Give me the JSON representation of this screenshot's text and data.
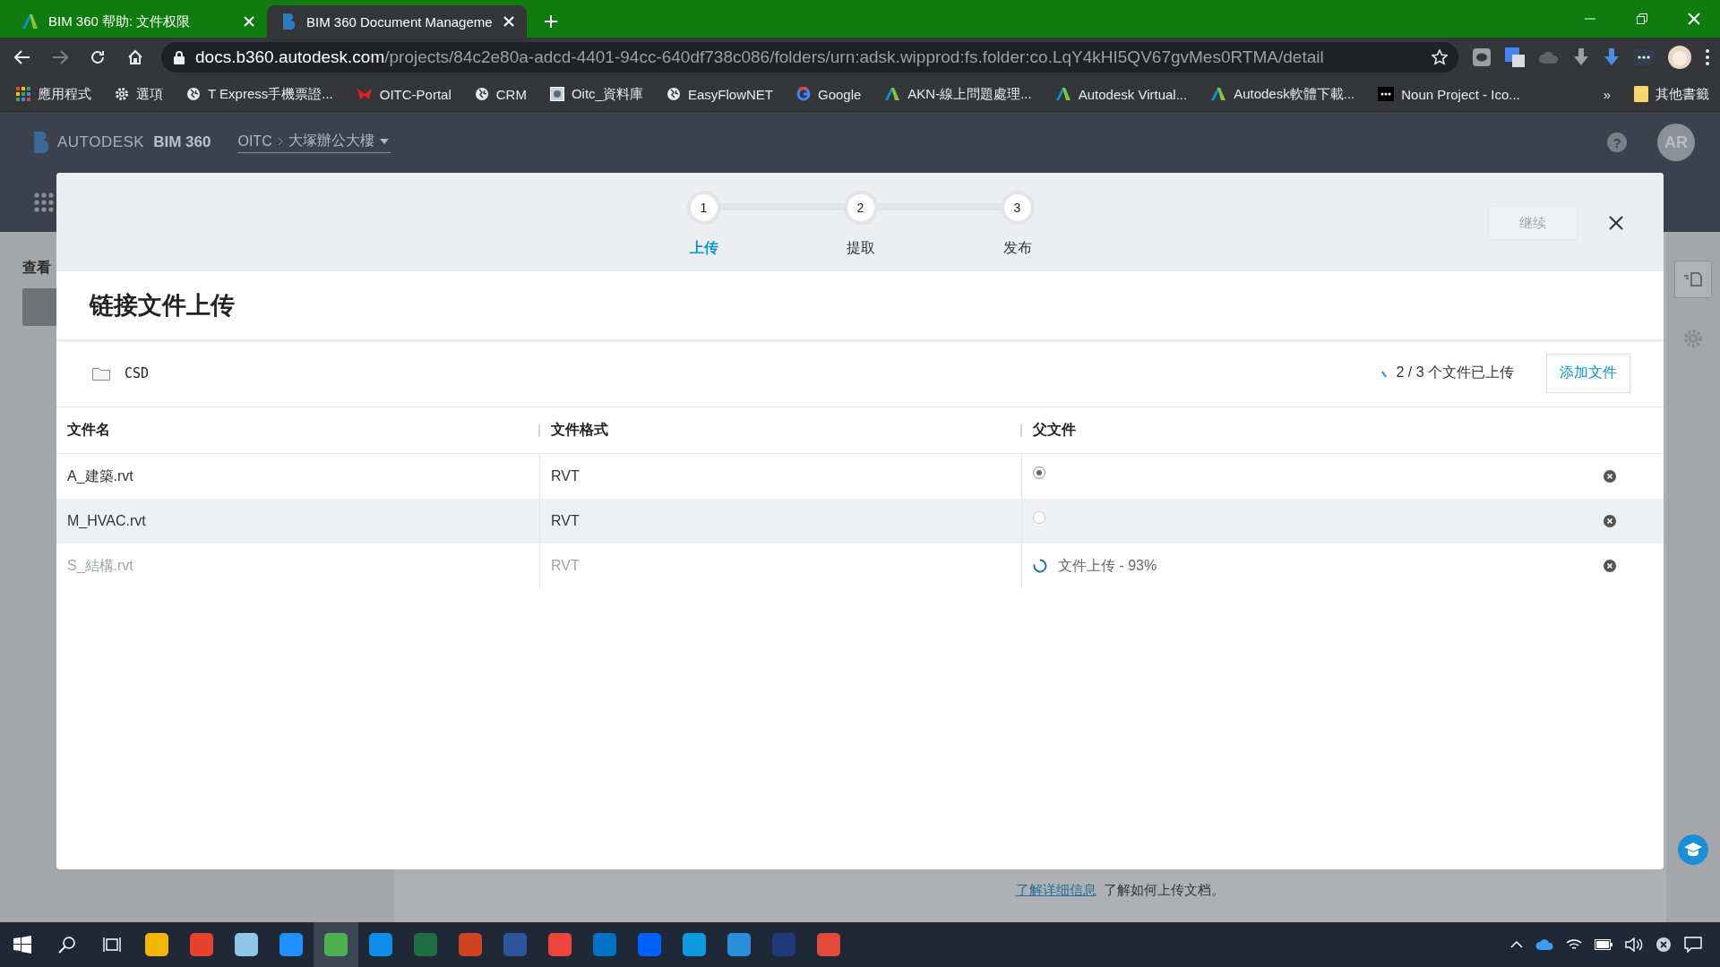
{
  "browser": {
    "tabs": [
      {
        "title": "BIM 360 帮助: 文件权限",
        "selected": false
      },
      {
        "title": "BIM 360 Document Manageme",
        "selected": true
      }
    ],
    "url": {
      "host": "docs.b360.autodesk.com",
      "path": "/projects/84c2e80a-adcd-4401-94cc-640df738c086/folders/urn:adsk.wipprod:fs.folder:co.LqY4kHI5QV67gvMes0RTMA/detail"
    },
    "bookmarks": [
      {
        "label": "應用程式",
        "kind": "apps"
      },
      {
        "label": "選項",
        "kind": "gear"
      },
      {
        "label": "T Express手機票證...",
        "kind": "globe"
      },
      {
        "label": "OITC-Portal",
        "kind": "bird"
      },
      {
        "label": "CRM",
        "kind": "globe"
      },
      {
        "label": "Oitc_資料庫",
        "kind": "db"
      },
      {
        "label": "EasyFlowNET",
        "kind": "globe"
      },
      {
        "label": "Google",
        "kind": "google"
      },
      {
        "label": "AKN-線上問題處理...",
        "kind": "autodesk"
      },
      {
        "label": "Autodesk Virtual...",
        "kind": "autodesk"
      },
      {
        "label": "Autodesk軟體下載...",
        "kind": "autodesk"
      },
      {
        "label": "Noun Project - Ico...",
        "kind": "noun"
      }
    ],
    "more_bookmarks": "»",
    "other_bookmarks": "其他書籤"
  },
  "app": {
    "brand": "AUTODESK",
    "product": "BIM 360",
    "breadcrumb": [
      "OITC",
      "大塚辦公大樓"
    ],
    "help": "?",
    "avatar": "AR",
    "side_label": "查看",
    "footer_link": "了解详细信息",
    "footer_text": "了解如何上传文档。"
  },
  "dialog": {
    "steps": [
      {
        "number": "1",
        "label": "上传",
        "selected": true
      },
      {
        "number": "2",
        "label": "提取",
        "selected": false
      },
      {
        "number": "3",
        "label": "发布",
        "selected": false
      }
    ],
    "continue_button": {
      "label": "继续",
      "disabled": true
    },
    "title": "链接文件上传",
    "folder": "CSD",
    "upload_status": "2 / 3 个文件已上传",
    "add_button": "添加文件",
    "columns": [
      "文件名",
      "文件格式",
      "父文件"
    ],
    "rows": [
      {
        "name": "A_建築.rvt",
        "format": "RVT",
        "kind": "radio",
        "checked": true,
        "disabled": false,
        "selected": false
      },
      {
        "name": "M_HVAC.rvt",
        "format": "RVT",
        "kind": "radio",
        "checked": false,
        "disabled": false,
        "selected": true
      },
      {
        "name": "S_結構.rvt",
        "format": "RVT",
        "kind": "uploading",
        "status": "文件上传 - 93%",
        "disabled": true,
        "selected": false
      }
    ]
  },
  "taskbar": {
    "apps": [
      {
        "color": "#f2b705",
        "active": false
      },
      {
        "color": "#e8412c",
        "active": false
      },
      {
        "color": "#8fc6e8",
        "active": false
      },
      {
        "color": "#1e90ff",
        "active": false
      },
      {
        "color": "#4caf50",
        "active": true
      },
      {
        "color": "#0e8ee9",
        "active": false
      },
      {
        "color": "#1d6f42",
        "active": false
      },
      {
        "color": "#d04423",
        "active": false
      },
      {
        "color": "#2b579a",
        "active": false
      },
      {
        "color": "#ef443b",
        "active": false
      },
      {
        "color": "#0072c6",
        "active": false
      },
      {
        "color": "#0061ff",
        "active": false
      },
      {
        "color": "#0c9be0",
        "active": false
      },
      {
        "color": "#2a8fd8",
        "active": false
      },
      {
        "color": "#1e3a7a",
        "active": false
      },
      {
        "color": "#e24b3b",
        "active": false
      }
    ]
  }
}
